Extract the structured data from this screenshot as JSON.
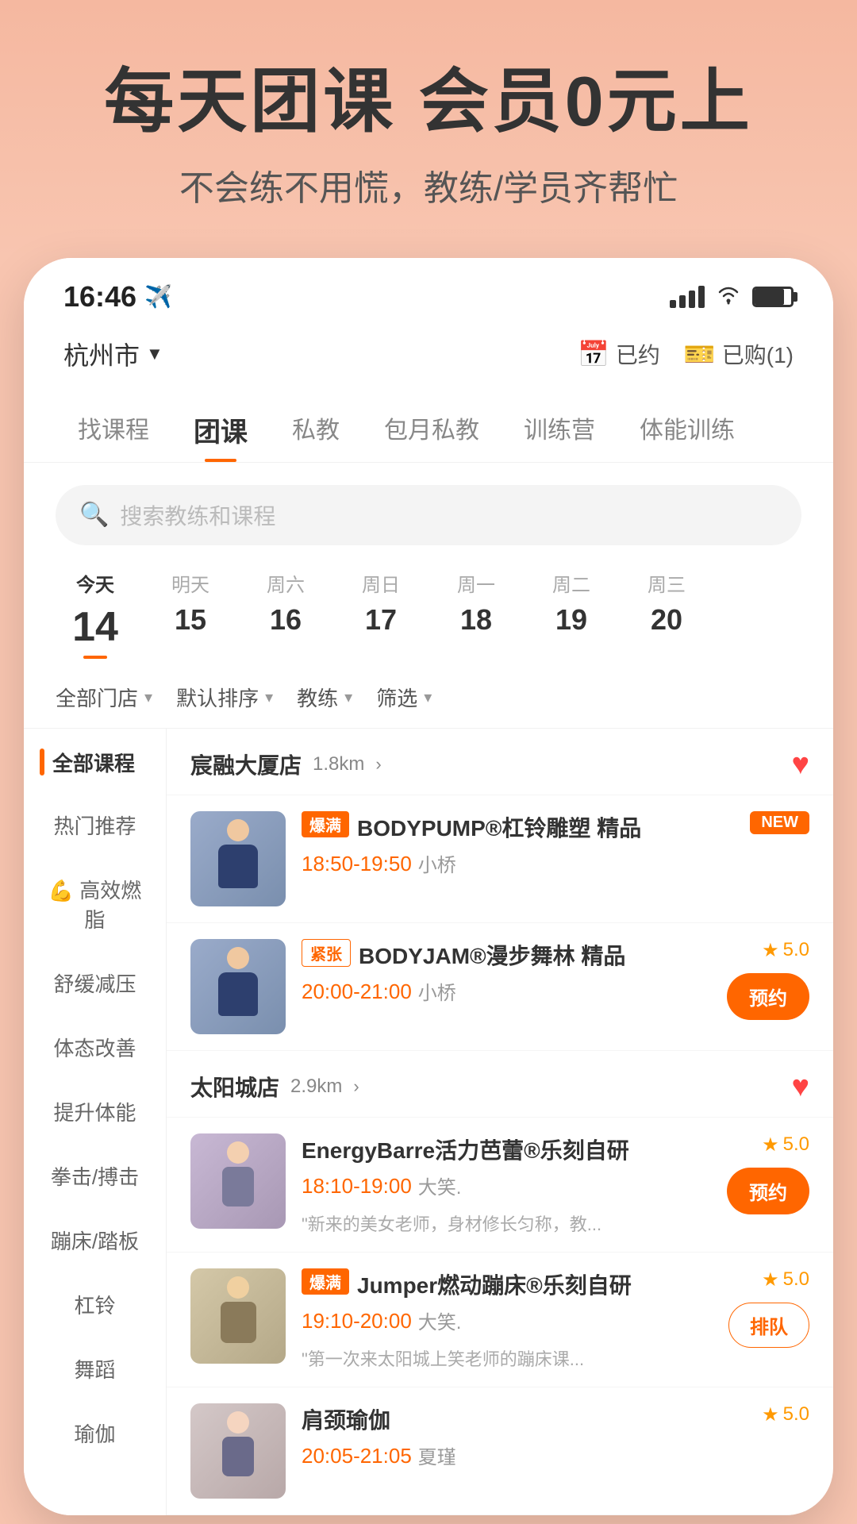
{
  "hero": {
    "title": "每天团课 会员0元上",
    "subtitle": "不会练不用慌，教练/学员齐帮忙"
  },
  "statusBar": {
    "time": "16:46",
    "locationIcon": "📍"
  },
  "topNav": {
    "city": "杭州市",
    "reserved": "已约",
    "purchased": "已购(1)"
  },
  "tabs": [
    {
      "label": "找课程",
      "active": false
    },
    {
      "label": "团课",
      "active": true
    },
    {
      "label": "私教",
      "active": false
    },
    {
      "label": "包月私教",
      "active": false
    },
    {
      "label": "训练营",
      "active": false
    },
    {
      "label": "体能训练",
      "active": false
    }
  ],
  "search": {
    "placeholder": "搜索教练和课程"
  },
  "dates": [
    {
      "dayName": "今天",
      "dayNum": "14",
      "isToday": true
    },
    {
      "dayName": "明天",
      "dayNum": "15",
      "isToday": false
    },
    {
      "dayName": "周六",
      "dayNum": "16",
      "isToday": false
    },
    {
      "dayName": "周日",
      "dayNum": "17",
      "isToday": false
    },
    {
      "dayName": "周一",
      "dayNum": "18",
      "isToday": false
    },
    {
      "dayName": "周二",
      "dayNum": "19",
      "isToday": false
    },
    {
      "dayName": "周三",
      "dayNum": "20",
      "isToday": false
    }
  ],
  "filters": [
    {
      "label": "全部门店"
    },
    {
      "label": "默认排序"
    },
    {
      "label": "教练"
    },
    {
      "label": "筛选"
    }
  ],
  "sidebar": {
    "header": "全部课程",
    "items": [
      {
        "label": "热门推荐",
        "active": false
      },
      {
        "label": "💪 高效燃脂",
        "active": false
      },
      {
        "label": "舒缓减压",
        "active": false
      },
      {
        "label": "体态改善",
        "active": false
      },
      {
        "label": "提升体能",
        "active": false
      },
      {
        "label": "拳击/搏击",
        "active": false
      },
      {
        "label": "蹦床/踏板",
        "active": false
      },
      {
        "label": "杠铃",
        "active": false
      },
      {
        "label": "舞蹈",
        "active": false
      },
      {
        "label": "瑜伽",
        "active": false
      }
    ]
  },
  "stores": [
    {
      "name": "宸融大厦店",
      "distance": "1.8km",
      "favorited": true,
      "courses": [
        {
          "badge": "爆满",
          "badgeType": "hot",
          "name": "BODYPUMP®杠铃雕塑 精品",
          "tag": "NEW",
          "tagType": "new",
          "time": "18:50-19:50",
          "teacher": "小桥",
          "rating": null,
          "desc": "",
          "action": "none"
        },
        {
          "badge": "紧张",
          "badgeType": "tight",
          "name": "BODYJAM®漫步舞林 精品",
          "tag": null,
          "tagType": null,
          "time": "20:00-21:00",
          "teacher": "小桥",
          "rating": "5.0",
          "desc": "",
          "action": "book"
        }
      ]
    },
    {
      "name": "太阳城店",
      "distance": "2.9km",
      "favorited": true,
      "courses": [
        {
          "badge": null,
          "badgeType": null,
          "name": "EnergyBarre活力芭蕾®乐刻自研",
          "tag": null,
          "tagType": null,
          "time": "18:10-19:00",
          "teacher": "大笑.",
          "rating": "5.0",
          "desc": "\"新来的美女老师，身材修长匀称，教...",
          "action": "book"
        },
        {
          "badge": "爆满",
          "badgeType": "hot",
          "name": "Jumper燃动蹦床®乐刻自研",
          "tag": null,
          "tagType": null,
          "time": "19:10-20:00",
          "teacher": "大笑.",
          "rating": "5.0",
          "desc": "\"第一次来太阳城上笑老师的蹦床课...",
          "action": "queue"
        },
        {
          "badge": null,
          "badgeType": null,
          "name": "肩颈瑜伽",
          "tag": null,
          "tagType": null,
          "time": "20:05-21:05",
          "teacher": "夏瑾",
          "rating": "5.0",
          "desc": "",
          "action": "book"
        }
      ]
    }
  ]
}
